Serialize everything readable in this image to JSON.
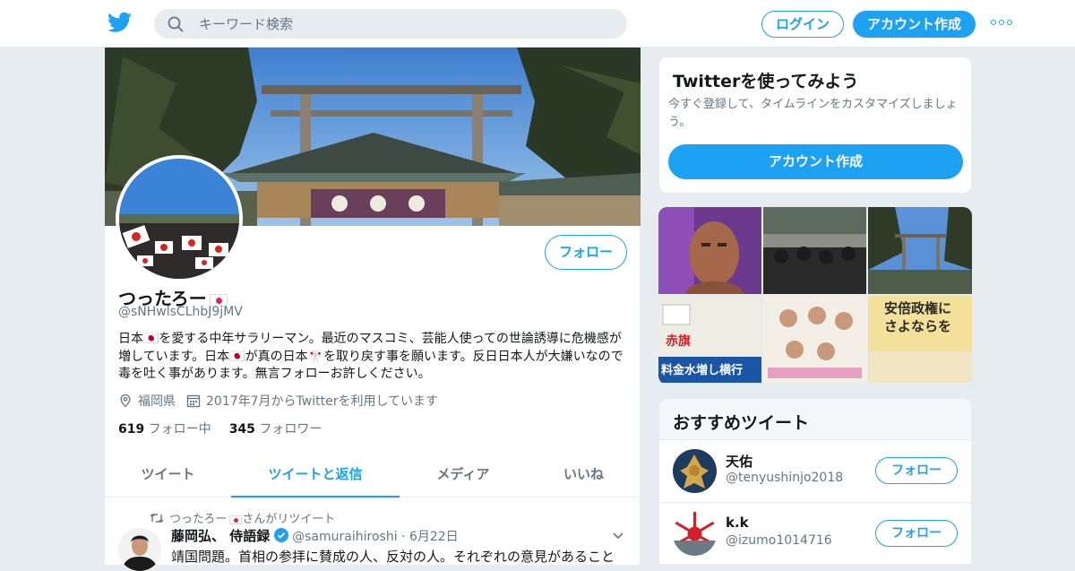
{
  "header": {
    "search_placeholder": "キーワード検索",
    "login_label": "ログイン",
    "signup_label": "アカウント作成"
  },
  "profile": {
    "name": "つったろー",
    "handle": "@sNHwlsCLhbJ9jMV",
    "bio": "日本🇯🇵を愛する中年サラリーマン。最近のマスコミ、芸能人使っての世論誘導に危機感が増しています。日本🇯🇵が真の日本🎌を取り戻す事を願います。反日日本人が大嫌いなので毒を吐く事があります。無言フォローお許しください。",
    "location": "福岡県",
    "joined": "2017年7月からTwitterを利用しています",
    "following_count": "619",
    "following_label": "フォロー中",
    "followers_count": "345",
    "followers_label": "フォロワー",
    "follow_label": "フォロー",
    "tabs": [
      "ツイート",
      "ツイートと返信",
      "メディア",
      "いいね"
    ],
    "active_tab": "ツイートと返信"
  },
  "tweet": {
    "retweeted_by": "つったろー",
    "retweet_suffix": "さんがリツイート",
    "author_name": "藤岡弘、 侍語録",
    "author_handle": "@samuraihiroshi",
    "date": "6月22日",
    "text": "靖国問題。首相の参拝に賛成の人、反対の人。それぞれの意見があること"
  },
  "signup_card": {
    "title": "Twitterを使ってみよう",
    "description": "今すぐ登録して、タイムラインをカスタマイズしましょう。",
    "button_label": "アカウント作成"
  },
  "media_tiles": [
    {
      "caption": ""
    },
    {
      "caption": ""
    },
    {
      "caption": ""
    },
    {
      "caption": "料金水増し横行"
    },
    {
      "caption": ""
    },
    {
      "caption": "安倍政権にさよならを"
    }
  ],
  "recommended": {
    "title": "おすすめツイート",
    "items": [
      {
        "name": "天佑",
        "handle": "@tenyushinjo2018",
        "follow_label": "フォロー"
      },
      {
        "name": "k.k",
        "handle": "@izumo1014716",
        "follow_label": "フォロー"
      }
    ]
  },
  "colors": {
    "accent": "#1da1f2",
    "background": "#e6ecf0",
    "secondary_text": "#657786"
  }
}
